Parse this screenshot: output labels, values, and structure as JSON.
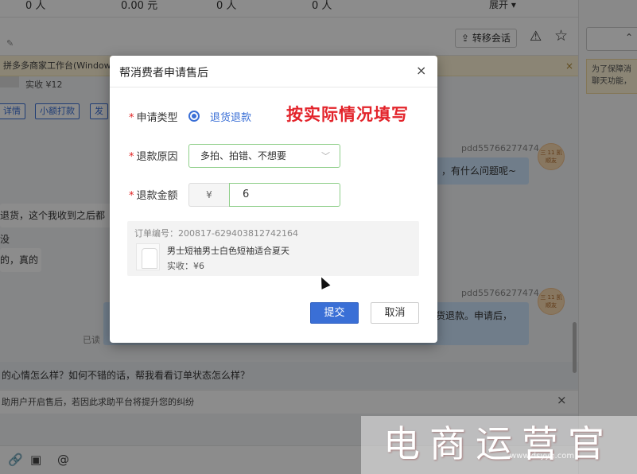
{
  "background": {
    "stats": [
      "0 人",
      "0.00 元",
      "0 人",
      "0 人"
    ],
    "expand_label": "展开 ▾",
    "transfer_button": "⇪ 转移会话",
    "notice_text": "拼多多商家工作台(Window",
    "order_paid": "实收 ¥12",
    "order_buttons": [
      "详情",
      "小额打款",
      "发"
    ],
    "messages": [
      {
        "sender": "pdd55766277474",
        "text": "，有什么问题呢~"
      },
      {
        "text": "退货，这个我收到之后都没"
      },
      {
        "text": "的，真的"
      },
      {
        "sender": "pdd55766277474",
        "text": "货退款。申请后，"
      }
    ],
    "avatar_text": "三 11\n凯顺友",
    "read_label": "已读",
    "suggestion": "的心情怎么样？如何不错的话，帮我看看订单状态怎么样？",
    "tip": "助用户开启售后，若因此求助平台将提升您的纠纷",
    "right_notice": [
      "为了保障消",
      "聊天功能，"
    ]
  },
  "modal": {
    "title": "帮消费者申请售后",
    "close_label": "×",
    "type_label": "申请类型",
    "type_value": "退货退款",
    "annotation": "按实际情况填写",
    "reason_label": "退款原因",
    "reason_value": "多拍、拍错、不想要",
    "amount_label": "退款金额",
    "currency": "¥",
    "amount_value": "6",
    "order": {
      "number_text": "订单编号：200817-629403812742164",
      "product_name": "男士短袖男士白色短袖适合夏天",
      "paid_text": "实收：¥6"
    },
    "submit_label": "提交",
    "cancel_label": "取消",
    "required_mark": "*"
  },
  "watermark": {
    "text": "电商运营官",
    "url": "www.dsyyg.com"
  },
  "colors": {
    "accent": "#3a6fd6",
    "annotation": "#e3242b",
    "required": "#e02020",
    "input_border": "#8fcf8a"
  }
}
